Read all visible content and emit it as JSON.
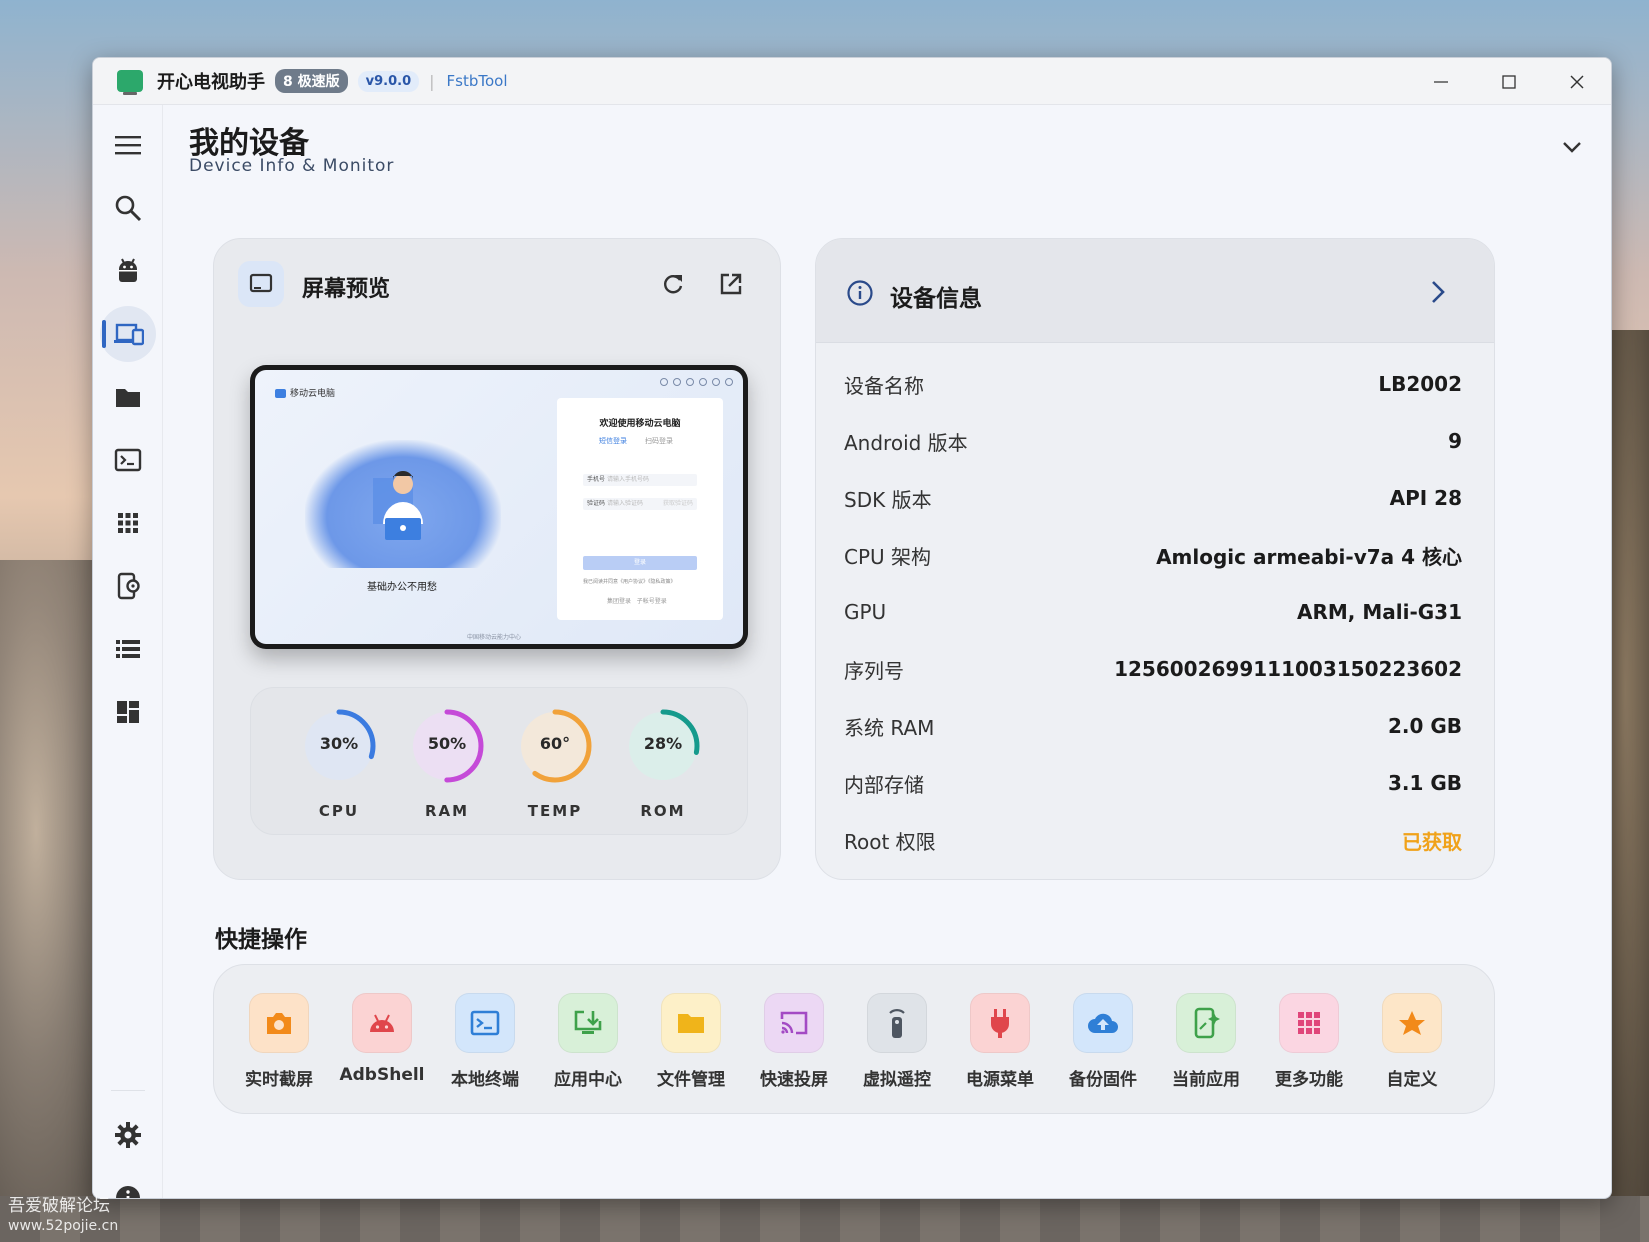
{
  "window": {
    "app_title": "开心电视助手",
    "edition_badge": "8 极速版",
    "version_badge": "v9.0.0",
    "separator": "|",
    "brand": "FstbTool",
    "controls": {
      "minimize": "—",
      "maximize": "☐",
      "close": "✕"
    }
  },
  "sidebar": {
    "items": [
      {
        "id": "menu",
        "icon": "hamburger-menu-icon",
        "active": false
      },
      {
        "id": "search",
        "icon": "search-icon",
        "active": false
      },
      {
        "id": "android",
        "icon": "android-icon",
        "active": false
      },
      {
        "id": "devices",
        "icon": "devices-icon",
        "active": true
      },
      {
        "id": "files",
        "icon": "folder-icon",
        "active": false
      },
      {
        "id": "terminal",
        "icon": "terminal-icon",
        "active": false
      },
      {
        "id": "apps",
        "icon": "apps-grid-icon",
        "active": false
      },
      {
        "id": "device-settings",
        "icon": "phone-settings-icon",
        "active": false
      },
      {
        "id": "list",
        "icon": "list-icon",
        "active": false
      },
      {
        "id": "dashboard",
        "icon": "dashboard-icon",
        "active": false
      },
      {
        "id": "settings",
        "icon": "gear-icon",
        "active": false
      },
      {
        "id": "about",
        "icon": "info-icon",
        "active": false
      }
    ]
  },
  "header": {
    "title": "我的设备",
    "subtitle": "Device Info & Monitor"
  },
  "preview": {
    "title": "屏幕预览",
    "screen": {
      "brand": "移动云电脑",
      "caption": "基础办公不用愁",
      "login_title": "欢迎使用移动云电脑",
      "tab_sms": "短信登录",
      "tab_scan": "扫码登录",
      "field_phone_label": "手机号",
      "field_phone_placeholder": "请输入手机号码",
      "field_code_label": "验证码",
      "field_code_placeholder": "请输入验证码",
      "field_code_action": "获取验证码",
      "login_button": "登录",
      "agreement": "我已阅读并同意《用户协议》《隐私政策》",
      "other_login_a": "集团登录",
      "other_login_b": "子帐号登录",
      "footer": "中国移动云能力中心"
    },
    "gauges": [
      {
        "id": "cpu",
        "value_text": "30%",
        "value": 30,
        "label": "CPU",
        "color": "#3b7be0"
      },
      {
        "id": "ram",
        "value_text": "50%",
        "value": 50,
        "label": "RAM",
        "color": "#c54ad8"
      },
      {
        "id": "temp",
        "value_text": "60°",
        "value": 60,
        "label": "TEMP",
        "color": "#f1a23a"
      },
      {
        "id": "rom",
        "value_text": "28%",
        "value": 28,
        "label": "ROM",
        "color": "#159a8c"
      }
    ]
  },
  "device_info": {
    "title": "设备信息",
    "rows": [
      {
        "key": "设备名称",
        "value": "LB2002"
      },
      {
        "key": "Android 版本",
        "value": "9"
      },
      {
        "key": "SDK 版本",
        "value": "API 28"
      },
      {
        "key": "CPU 架构",
        "value": "Amlogic armeabi-v7a 4 核心"
      },
      {
        "key": "GPU",
        "value": "ARM, Mali-G31"
      },
      {
        "key": "序列号",
        "value": "1256002699111003150223602"
      },
      {
        "key": "系统 RAM",
        "value": "2.0 GB"
      },
      {
        "key": "内部存储",
        "value": "3.1 GB"
      },
      {
        "key": "Root 权限",
        "value": "已获取",
        "status_color": "#f0a21a"
      }
    ]
  },
  "quick_actions": {
    "title": "快捷操作",
    "items": [
      {
        "label": "实时截屏",
        "icon": "camera-icon",
        "bg": "#fde2c8",
        "fg": "#f28a1a"
      },
      {
        "label": "AdbShell",
        "icon": "android-icon",
        "bg": "#fbd3d3",
        "fg": "#e0464b"
      },
      {
        "label": "本地终端",
        "icon": "terminal-icon",
        "bg": "#d3e6fb",
        "fg": "#2f7fd6"
      },
      {
        "label": "应用中心",
        "icon": "install-app-icon",
        "bg": "#d8f0d8",
        "fg": "#3ea14a"
      },
      {
        "label": "文件管理",
        "icon": "folder-icon",
        "bg": "#fdf0c8",
        "fg": "#f0b41a"
      },
      {
        "label": "快速投屏",
        "icon": "cast-icon",
        "bg": "#ecd8f4",
        "fg": "#a34ac4"
      },
      {
        "label": "虚拟遥控",
        "icon": "remote-icon",
        "bg": "#dfe3e8",
        "fg": "#4e5661"
      },
      {
        "label": "电源菜单",
        "icon": "power-plug-icon",
        "bg": "#fbd3d3",
        "fg": "#e0464b"
      },
      {
        "label": "备份固件",
        "icon": "cloud-upload-icon",
        "bg": "#d3e6fb",
        "fg": "#2f7fd6"
      },
      {
        "label": "当前应用",
        "icon": "current-app-icon",
        "bg": "#d8f0d8",
        "fg": "#3ea14a"
      },
      {
        "label": "更多功能",
        "icon": "more-grid-icon",
        "bg": "#fbd6e2",
        "fg": "#e0467a"
      },
      {
        "label": "自定义",
        "icon": "star-icon",
        "bg": "#fde6c8",
        "fg": "#f28a1a"
      }
    ]
  },
  "watermark": {
    "line1": "吾爱破解论坛",
    "line2": "www.52pojie.cn"
  }
}
